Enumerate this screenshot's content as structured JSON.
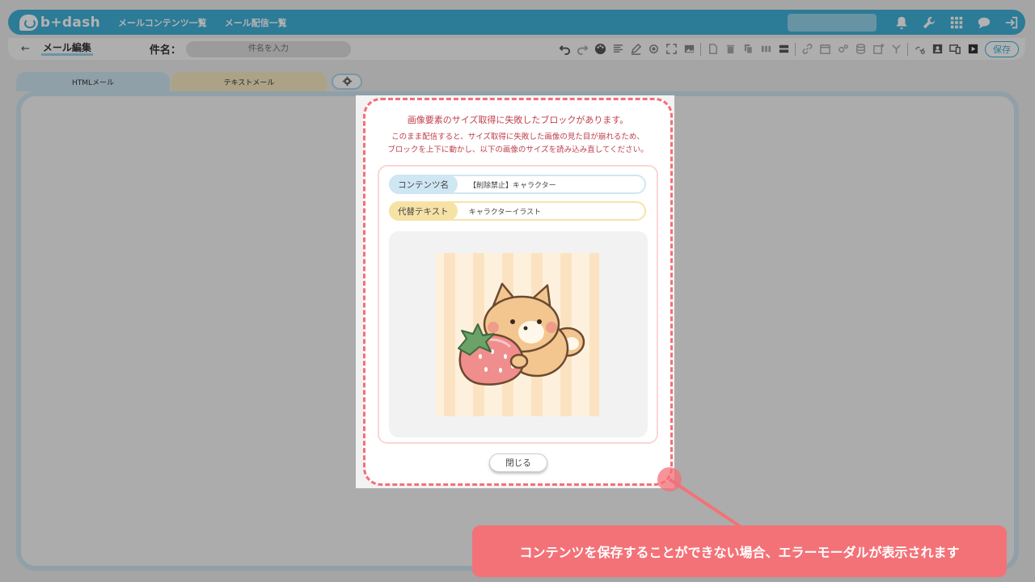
{
  "header": {
    "logo_text": "b+dash",
    "nav": [
      "メールコンテンツ一覧",
      "メール配信一覧"
    ],
    "icons": [
      "bell-icon",
      "wrench-icon",
      "grid-icon",
      "chat-icon",
      "logout-icon"
    ]
  },
  "toolbar": {
    "page_title": "メール編集",
    "subject_label": "件名：",
    "subject_placeholder": "件名を入力",
    "save_label": "保存"
  },
  "tabs": {
    "html": "HTMLメール",
    "text": "テキストメール"
  },
  "modal": {
    "title": "画像要素のサイズ取得に失敗したブロックがあります。",
    "message_line1": "このまま配信すると、サイズ取得に失敗した画像の見た目が崩れるため、",
    "message_line2": "ブロックを上下に動かし、以下の画像のサイズを読み込み直してください。",
    "content_name_label": "コンテンツ名",
    "content_name_value": "【削除禁止】キャラクター",
    "alt_text_label": "代替テキスト",
    "alt_text_value": "キャラクターイラスト",
    "close_label": "閉じる"
  },
  "annotation": {
    "text": "コンテンツを保存することができない場合、エラーモーダルが表示されます"
  },
  "colors": {
    "accent": "#3fb0d9",
    "error": "#f37278"
  }
}
